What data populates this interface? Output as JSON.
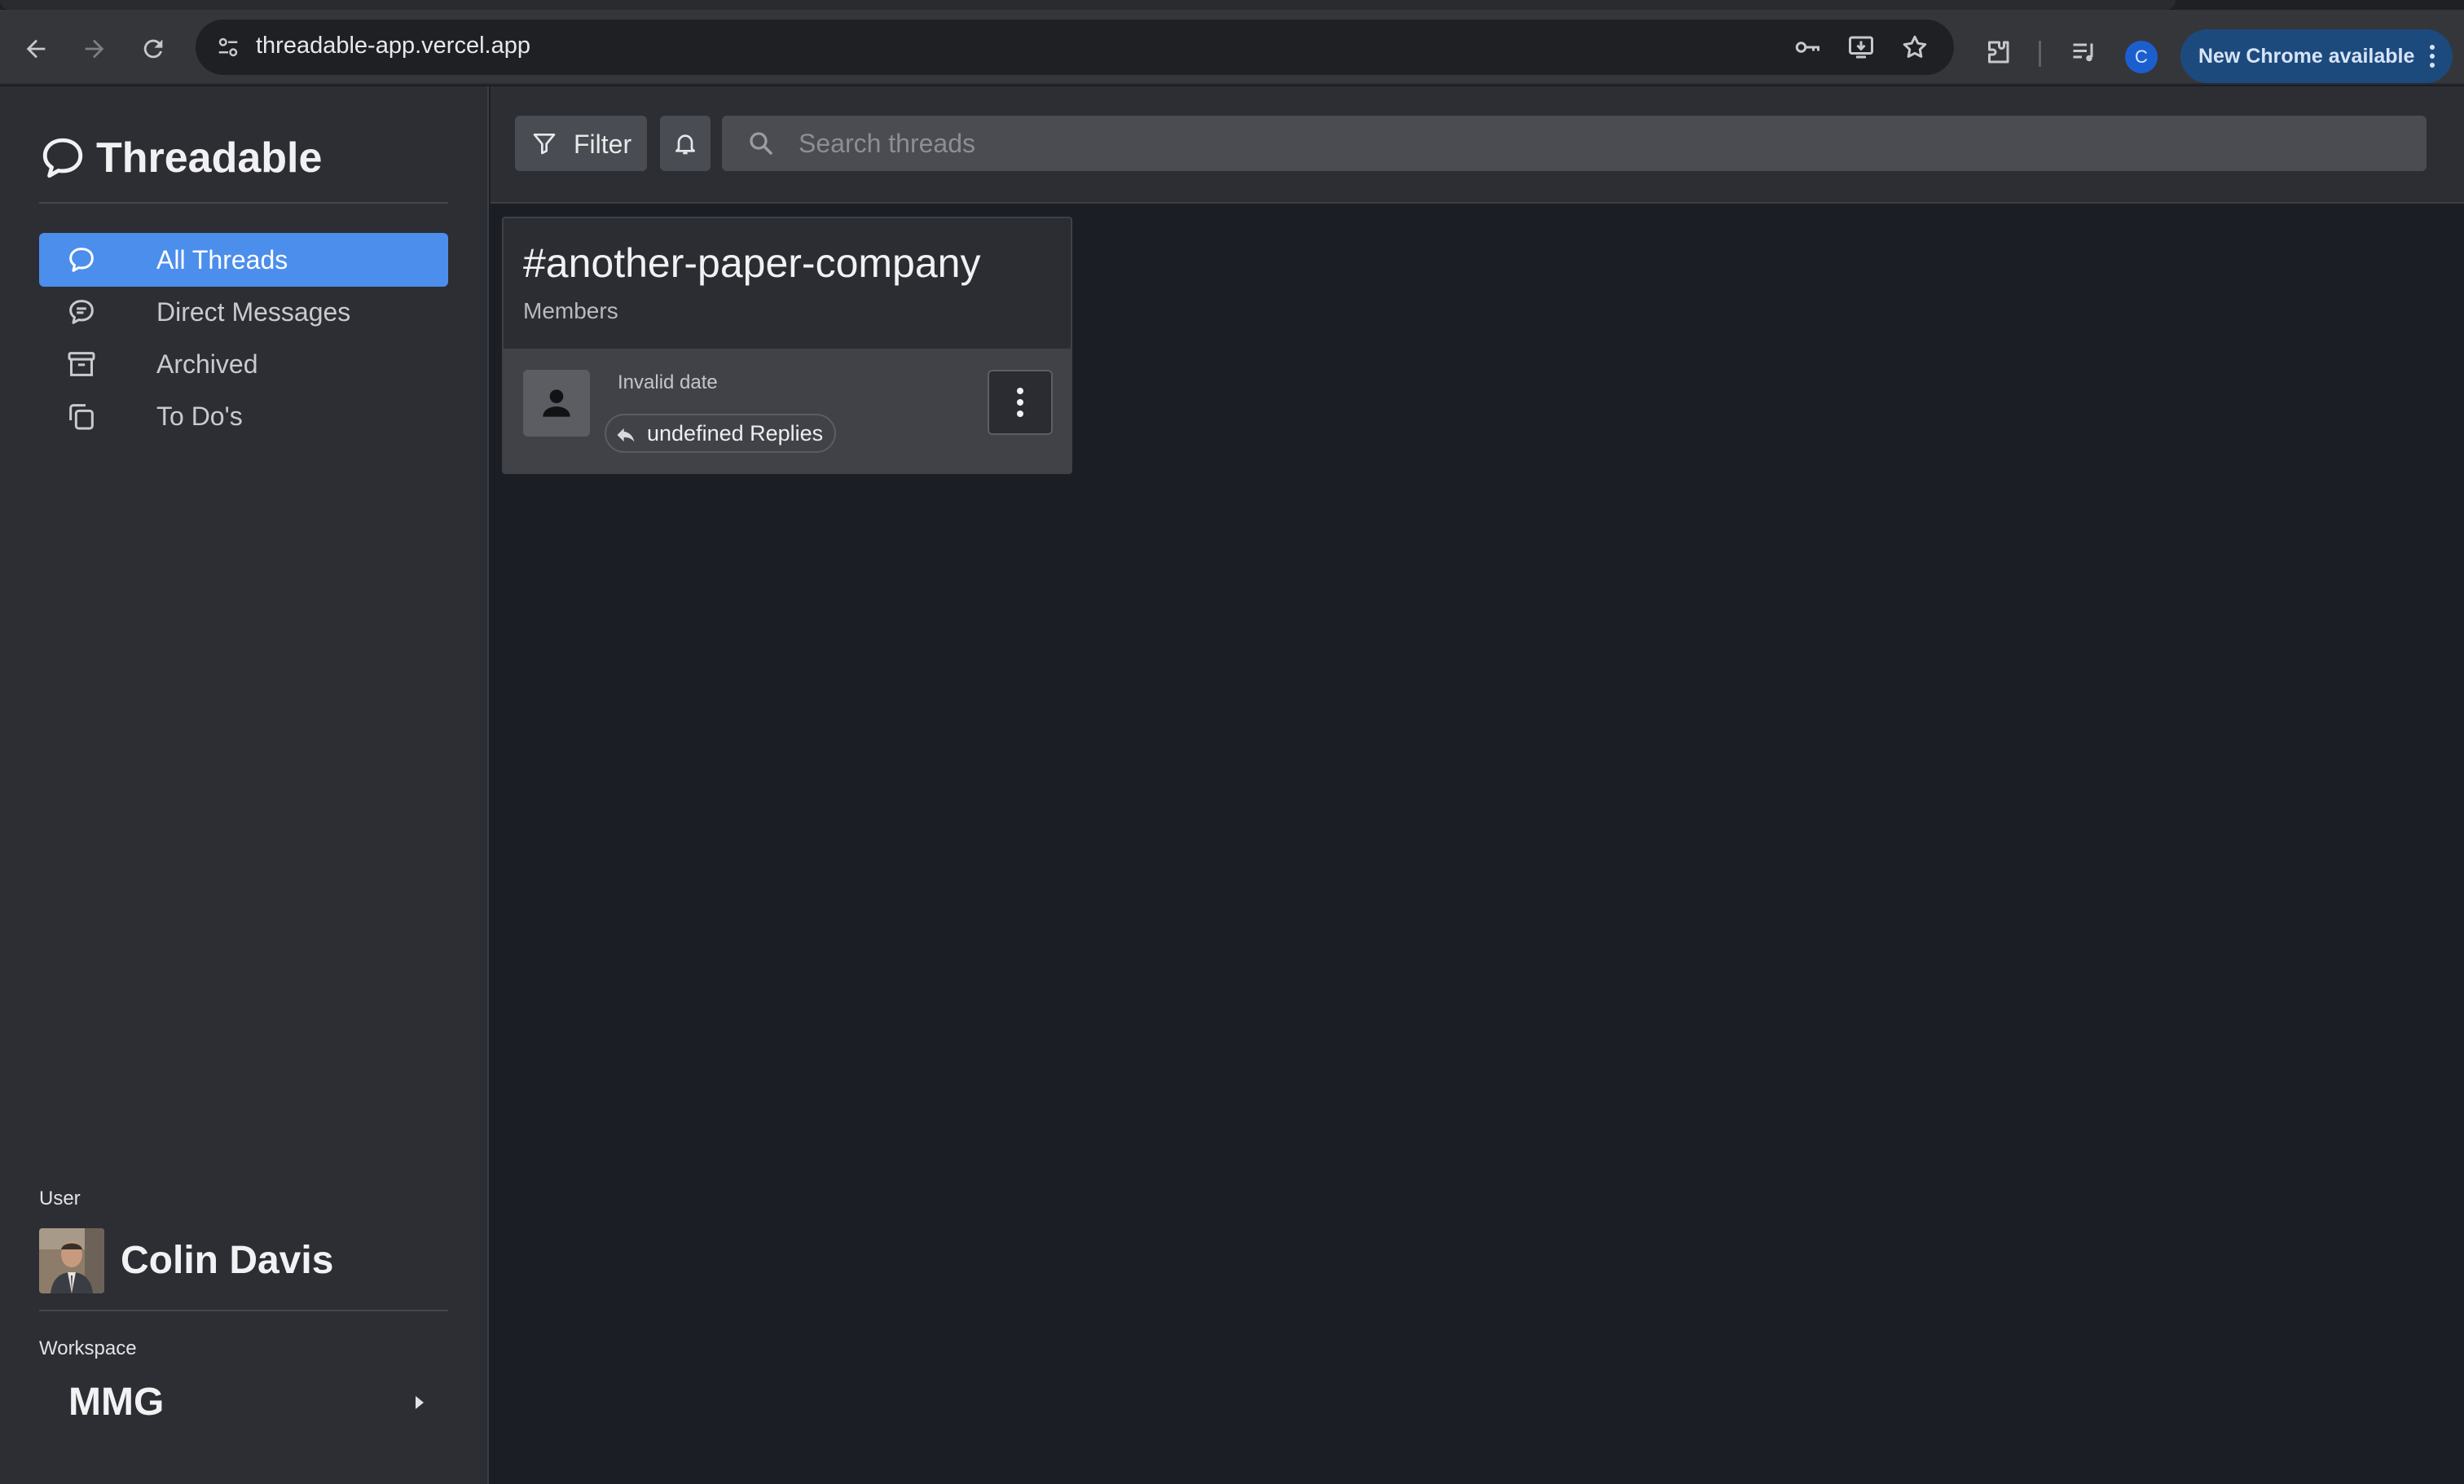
{
  "browser": {
    "url": "threadable-app.vercel.app",
    "profile_initial": "C",
    "update_label": "New Chrome available"
  },
  "app": {
    "brand": "Threadable"
  },
  "sidebar": {
    "items": [
      {
        "label": "All Threads",
        "icon": "chat-bubble-icon",
        "active": true
      },
      {
        "label": "Direct Messages",
        "icon": "message-lines-icon",
        "active": false
      },
      {
        "label": "Archived",
        "icon": "archive-box-icon",
        "active": false
      },
      {
        "label": "To Do's",
        "icon": "copy-pages-icon",
        "active": false
      }
    ],
    "user_section_label": "User",
    "user_name": "Colin Davis",
    "workspace_section_label": "Workspace",
    "workspace_name": "MMG"
  },
  "toolbar": {
    "filter_label": "Filter",
    "search_placeholder": "Search threads"
  },
  "thread_card": {
    "title": "#another-paper-company",
    "subtitle": "Members",
    "message": {
      "date": "Invalid date",
      "replies_label": "undefined Replies"
    }
  },
  "colors": {
    "accent": "#4c8eec",
    "sidebar_bg": "#2c2e33",
    "main_bg": "#1b1e25",
    "chrome_update": "#1c4a7d"
  }
}
